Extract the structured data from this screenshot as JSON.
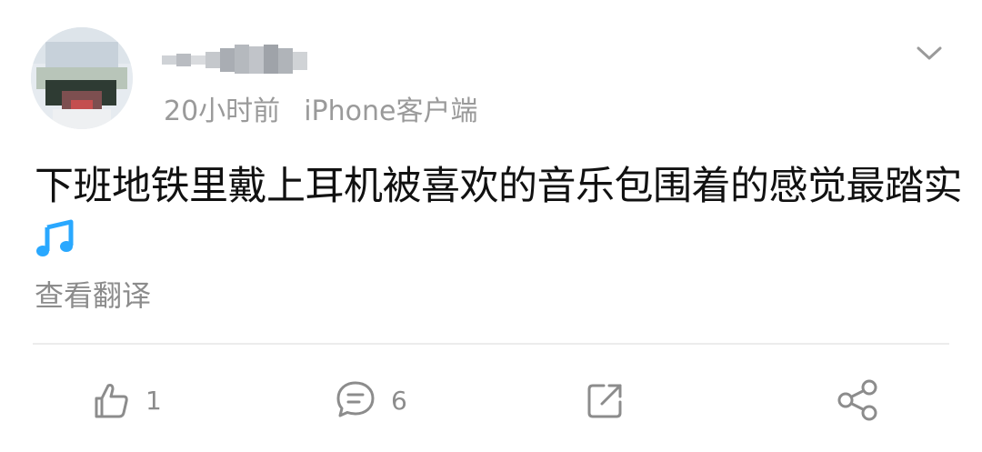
{
  "post": {
    "author_name": "",
    "time": "20小时前",
    "source": "iPhone客户端",
    "text": "下班地铁里戴上耳机被喜欢的音乐包围着的感觉最踏实",
    "emoji": "music-notes-icon",
    "translate_label": "查看翻译"
  },
  "actions": {
    "like_count": "1",
    "comment_count": "6"
  },
  "colors": {
    "meta_gray": "#9a9a9a",
    "icon_gray": "#8c8c8c",
    "emoji_blue": "#29a8ff"
  }
}
